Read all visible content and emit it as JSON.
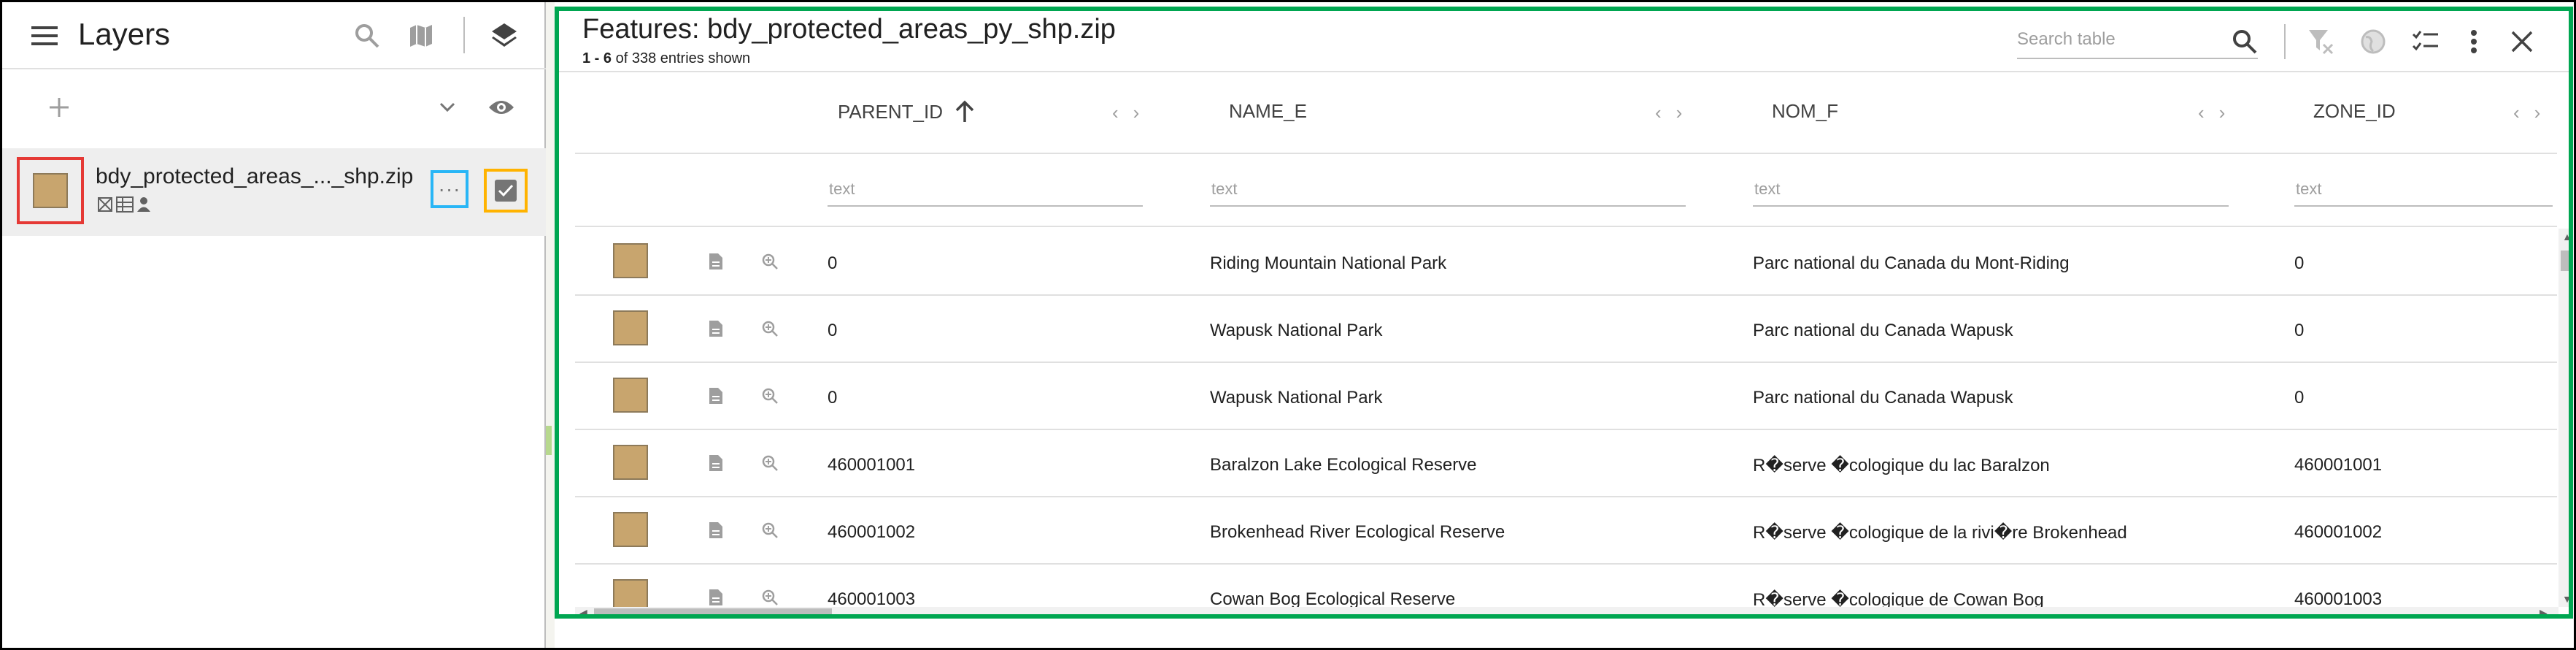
{
  "left_panel": {
    "title": "Layers",
    "layer": {
      "name": "bdy_protected_areas_..._shp.zip",
      "more_label": "···"
    }
  },
  "table": {
    "title": "Features: bdy_protected_areas_py_shp.zip",
    "count_range": "1 - 6",
    "count_rest": " of 338 entries shown",
    "search_placeholder": "Search table",
    "columns": [
      "PARENT_ID",
      "NAME_E",
      "NOM_F",
      "ZONE_ID"
    ],
    "filter_placeholder": "text",
    "rows": [
      [
        "0",
        "Riding Mountain National Park",
        "Parc national du Canada du Mont-Riding",
        "0"
      ],
      [
        "0",
        "Wapusk National Park",
        "Parc national du Canada Wapusk",
        "0"
      ],
      [
        "0",
        "Wapusk National Park",
        "Parc national du Canada Wapusk",
        "0"
      ],
      [
        "460001001",
        "Baralzon Lake Ecological Reserve",
        "R�serve �cologique du lac Baralzon",
        "460001001"
      ],
      [
        "460001002",
        "Brokenhead River Ecological Reserve",
        "R�serve �cologique de la rivi�re Brokenhead",
        "460001002"
      ],
      [
        "460001003",
        "Cowan Bog Ecological Reserve",
        "R�serve �cologique de Cowan Bog",
        "460001003"
      ]
    ]
  },
  "colors": {
    "feature_swatch": "#c8a56e",
    "highlight_red": "#e53935",
    "highlight_blue": "#29b6f6",
    "highlight_orange": "#ffb300",
    "highlight_green": "#00a651"
  },
  "icons": [
    "menu-icon",
    "search-icon",
    "map-icon",
    "layers-icon",
    "add-icon",
    "chevron-down-icon",
    "eye-icon",
    "checkbox-icon",
    "filter-clear-icon",
    "globe-icon",
    "checklist-icon",
    "kebab-icon",
    "close-icon",
    "details-icon",
    "zoom-icon",
    "sort-arrow-up-icon"
  ]
}
